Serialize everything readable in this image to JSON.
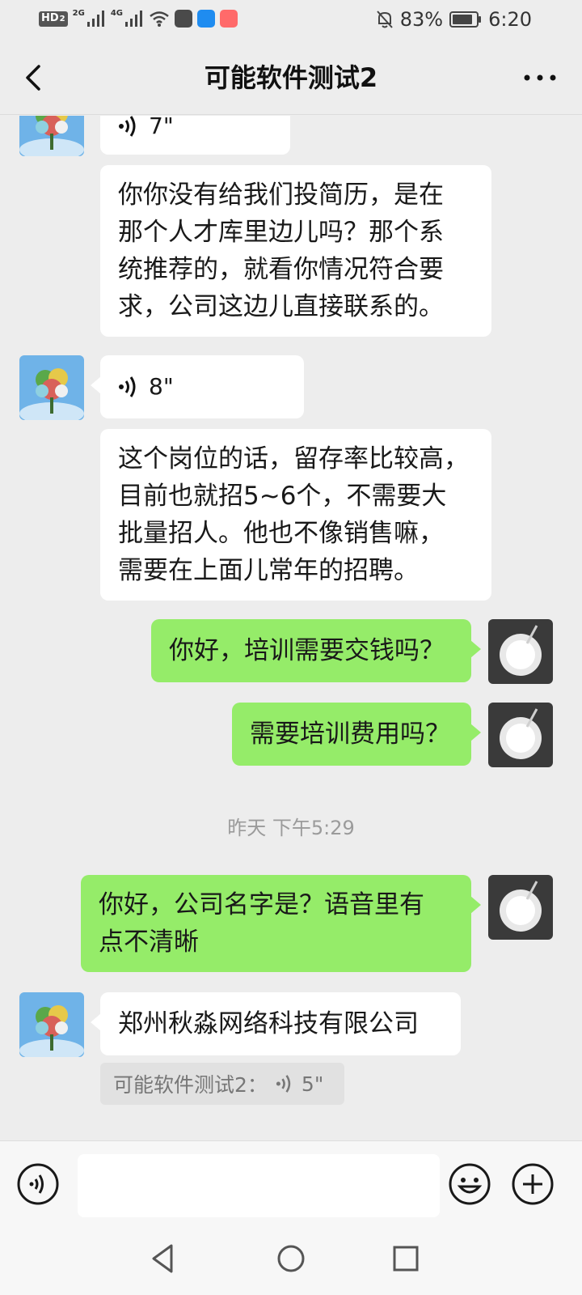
{
  "status_bar": {
    "hd_label": "HD",
    "hd_index": "2",
    "net1": "2G",
    "net2": "4G",
    "battery": "83%",
    "time": "6:20"
  },
  "header": {
    "title": "可能软件测试2"
  },
  "messages": {
    "m0": {
      "side": "left",
      "type": "voice",
      "duration": "7\""
    },
    "m1": {
      "side": "left",
      "type": "text",
      "lines": [
        "你你没有给我们投简历，是在",
        "那个人才库里边儿吗？那个系",
        "统推荐的，就看你情况符合要",
        "求，公司这边儿直接联系的。"
      ]
    },
    "m2": {
      "side": "left",
      "type": "voice",
      "duration": "8\""
    },
    "m3": {
      "side": "left",
      "type": "text",
      "lines": [
        "这个岗位的话，留存率比较高，",
        "目前也就招5~6个，不需要大",
        "批量招人。他也不像销售嘛，",
        "需要在上面儿常年的招聘。"
      ]
    },
    "m4": {
      "side": "right",
      "type": "text",
      "lines": [
        "你好，培训需要交钱吗？"
      ]
    },
    "m5": {
      "side": "right",
      "type": "text",
      "lines": [
        "需要培训费用吗？"
      ]
    },
    "timestamp": "昨天 下午5:29",
    "m6": {
      "side": "right",
      "type": "text",
      "lines": [
        "你好，公司名字是？语音里有",
        "点不清晰"
      ]
    },
    "m7": {
      "side": "left",
      "type": "text",
      "lines": [
        "郑州秋淼网络科技有限公司"
      ]
    },
    "quote": {
      "sender": "可能软件测试2：",
      "duration": "5\""
    }
  },
  "input_bar": {
    "voice_icon": "voice-mode-icon",
    "emoji_icon": "emoji-icon",
    "plus_icon": "plus-icon",
    "placeholder": ""
  },
  "nav_bar": {
    "icons": [
      "back-triangle-icon",
      "home-circle-icon",
      "recents-square-icon"
    ]
  },
  "colors": {
    "background": "#ededed",
    "incoming_bubble": "#ffffff",
    "outgoing_bubble": "#95ec69",
    "timestamp_text": "#9b9b9b"
  }
}
